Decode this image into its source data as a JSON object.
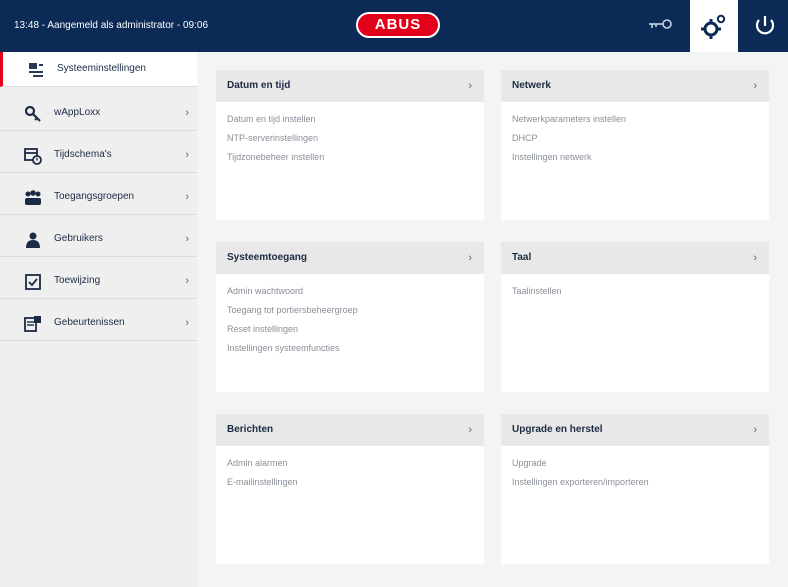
{
  "topbar": {
    "status_text": "13:48 - Aangemeld als administrator - 09:06",
    "logo_text": "ABUS"
  },
  "sidebar": {
    "items": [
      {
        "label": "Systeeminstellingen",
        "icon": "settings-sliders-icon",
        "active": true,
        "has_chevron": false
      },
      {
        "label": "wAppLoxx",
        "icon": "key-icon",
        "active": false,
        "has_chevron": true
      },
      {
        "label": "Tijdschema's",
        "icon": "calendar-clock-icon",
        "active": false,
        "has_chevron": true
      },
      {
        "label": "Toegangsgroepen",
        "icon": "group-icon",
        "active": false,
        "has_chevron": true
      },
      {
        "label": "Gebruikers",
        "icon": "user-icon",
        "active": false,
        "has_chevron": true
      },
      {
        "label": "Toewijzing",
        "icon": "checkbox-icon",
        "active": false,
        "has_chevron": true
      },
      {
        "label": "Gebeurtenissen",
        "icon": "event-log-icon",
        "active": false,
        "has_chevron": true
      }
    ]
  },
  "cards": [
    {
      "title": "Datum en tijd",
      "links": [
        "Datum en tijd instellen",
        "NTP-serverinstellingen",
        "Tijdzonebeheer instellen"
      ]
    },
    {
      "title": "Netwerk",
      "links": [
        "Netwerkparameters instellen",
        "DHCP",
        "Instellingen netwerk"
      ]
    },
    {
      "title": "Systeemtoegang",
      "links": [
        "Admin wachtwoord",
        "Toegang tot portiersbeheergroep",
        "Reset instellingen",
        "Instellingen systeemfuncties"
      ]
    },
    {
      "title": "Taal",
      "links": [
        "Taalinstellen"
      ]
    },
    {
      "title": "Berichten",
      "links": [
        "Admin alarmen",
        "E-mailinstellingen"
      ]
    },
    {
      "title": "Upgrade en herstel",
      "links": [
        "Upgrade",
        "Instellingen exporteren/importeren"
      ]
    }
  ],
  "chevron_glyph": "›",
  "colors": {
    "topbar": "#0b2b56",
    "accent": "#e2001a",
    "sidebar": "#efefef",
    "main_bg": "#f4f4f4",
    "card_header": "#e8e8e8"
  }
}
